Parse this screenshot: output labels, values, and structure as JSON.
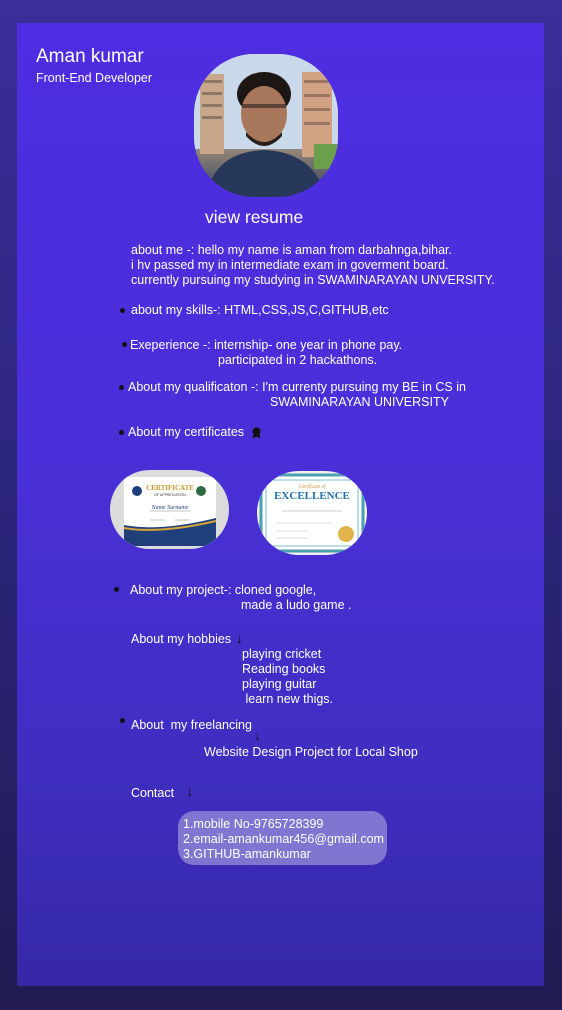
{
  "profile": {
    "name": "Aman kumar",
    "role": "Front-End Developer",
    "resume_label": "view resume"
  },
  "about": {
    "line1": "about me -: hello my name is aman from darbahnga,bihar.",
    "line2": "i hv passed my in intermediate exam in goverment board.",
    "line3": "currently pursuing my studying in SWAMINARAYAN UNVERSITY."
  },
  "skills": "about my skills-: HTML,CSS,JS,C,GITHUB,etc",
  "experience": {
    "line1": "Exeperience -: internship- one year in phone pay.",
    "line2": "participated in 2 hackathons."
  },
  "qualification": {
    "line1": "About my qualificaton -: I'm currenty pursuing my BE in CS  in",
    "line2": "SWAMINARAYAN UNIVERSITY"
  },
  "certificates": {
    "label": "About my certificates",
    "cert1_title": "CERTIFICATE",
    "cert1_subtitle": "OF APPRECIATION",
    "cert1_name": "Name Surname",
    "cert2_script": "Certificate of",
    "cert2_title": "EXCELLENCE"
  },
  "project": {
    "line1": "About my project-: cloned google,",
    "line2": "made a ludo game ."
  },
  "hobbies": {
    "label": "About my hobbies",
    "items": [
      "playing cricket",
      "Reading books",
      "playing  guitar",
      " learn new thigs."
    ]
  },
  "freelancing": {
    "label": "About  my freelancing",
    "project": "Website Design Project for Local Shop"
  },
  "contact": {
    "label": "Contact",
    "mobile": "1.mobile No-9765728399",
    "email": "2.email-amankumar456@gmail.com",
    "github": "3.GITHUB-amankumar"
  },
  "icons": {
    "arrow": "down-arrow-icon",
    "certificate_badge": "badge-icon",
    "bullet": "bullet-dot-icon"
  }
}
